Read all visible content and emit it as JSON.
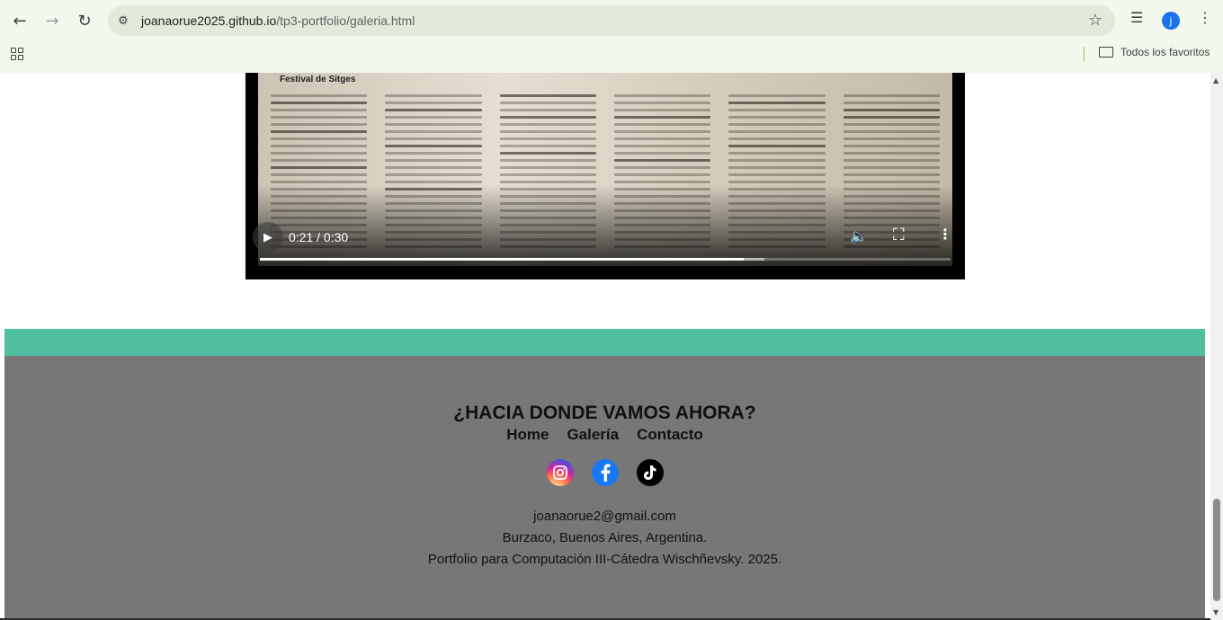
{
  "browser": {
    "url_domain": "joanaorue2025.github.io",
    "url_path": "/tp3-portfolio/galeria.html",
    "back_icon": "arrow-left",
    "forward_icon": "arrow-right",
    "reload_icon": "reload",
    "site_info_icon": "tune",
    "bookmark_star_icon": "star",
    "media_icon": "queue-music",
    "profile_initial": "j",
    "profile_color": "#1a73e8",
    "menu_icon": "more-vert",
    "apps_icon": "apps-grid",
    "bookmarks_folder": "Todos los favoritos"
  },
  "video": {
    "newspaper_headline": "Festival de Sitges",
    "current_time": "0:21",
    "duration": "0:30",
    "time_display": "0:21 / 0:30",
    "progress": 0.7,
    "buffered": 0.73,
    "play_icon": "play",
    "volume_icon": "volume",
    "fullscreen_icon": "fullscreen",
    "more_icon": "more-vert"
  },
  "footer": {
    "accent_color": "#4fbf9f",
    "background_color": "#777777",
    "title": "¿HACIA DONDE VAMOS AHORA?",
    "nav": {
      "home": "Home",
      "galeria": "Galería",
      "contacto": "Contacto"
    },
    "social": [
      "instagram",
      "facebook",
      "tiktok"
    ],
    "email": "joanaorue2@gmail.com",
    "location": "Burzaco, Buenos Aires, Argentina.",
    "credits": "Portfolio para Computación III-Cátedra Wischñevsky. 2025."
  }
}
